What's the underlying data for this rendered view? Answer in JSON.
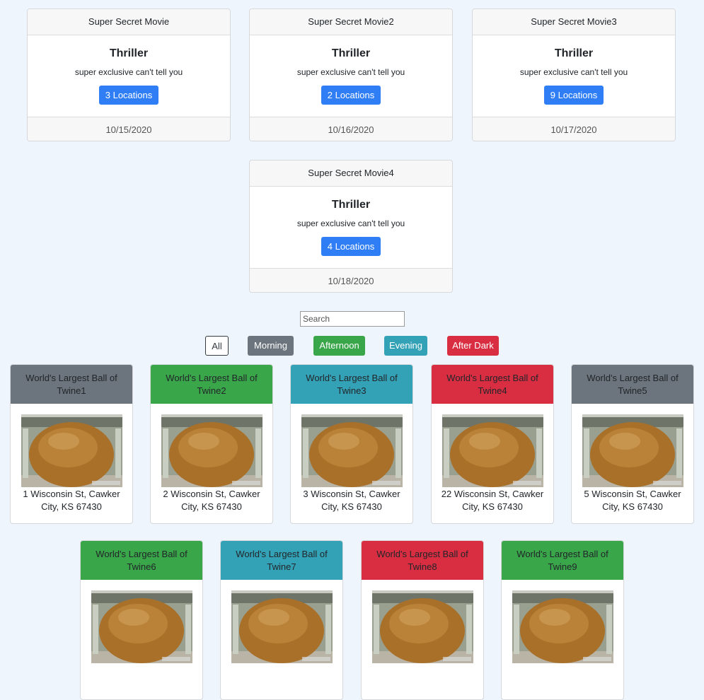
{
  "movies": [
    {
      "title": "Super Secret Movie",
      "genre": "Thriller",
      "description": "super exclusive can't tell you",
      "locations": "3 Locations",
      "date": "10/15/2020"
    },
    {
      "title": "Super Secret Movie2",
      "genre": "Thriller",
      "description": "super exclusive can't tell you",
      "locations": "2 Locations",
      "date": "10/16/2020"
    },
    {
      "title": "Super Secret Movie3",
      "genre": "Thriller",
      "description": "super exclusive can't tell you",
      "locations": "9 Locations",
      "date": "10/17/2020"
    },
    {
      "title": "Super Secret Movie4",
      "genre": "Thriller",
      "description": "super exclusive can't tell you",
      "locations": "4 Locations",
      "date": "10/18/2020"
    }
  ],
  "search": {
    "placeholder": "Search",
    "value": ""
  },
  "filters": {
    "all": "All",
    "morning": "Morning",
    "afternoon": "Afternoon",
    "evening": "Evening",
    "after_dark": "After Dark",
    "colors": {
      "morning": "#6c757d",
      "afternoon": "#3aa64a",
      "evening": "#34a2b6",
      "after_dark": "#d92e42",
      "all_border": "#343a40"
    }
  },
  "locations": [
    {
      "name": "World's Largest Ball of Twine1",
      "address": "1 Wisconsin St, Cawker City, KS 67430",
      "time": "morning"
    },
    {
      "name": "World's Largest Ball of Twine2",
      "address": "2 Wisconsin St, Cawker City, KS 67430",
      "time": "afternoon"
    },
    {
      "name": "World's Largest Ball of Twine3",
      "address": "3 Wisconsin St, Cawker City, KS 67430",
      "time": "evening"
    },
    {
      "name": "World's Largest Ball of Twine4",
      "address": "22 Wisconsin St, Cawker City, KS 67430",
      "time": "after_dark"
    },
    {
      "name": "World's Largest Ball of Twine5",
      "address": "5 Wisconsin St, Cawker City, KS 67430",
      "time": "morning"
    },
    {
      "name": "World's Largest Ball of Twine6",
      "address": "",
      "time": "afternoon"
    },
    {
      "name": "World's Largest Ball of Twine7",
      "address": "",
      "time": "evening"
    },
    {
      "name": "World's Largest Ball of Twine8",
      "address": "",
      "time": "after_dark"
    },
    {
      "name": "World's Largest Ball of Twine9",
      "address": "",
      "time": "afternoon"
    }
  ]
}
